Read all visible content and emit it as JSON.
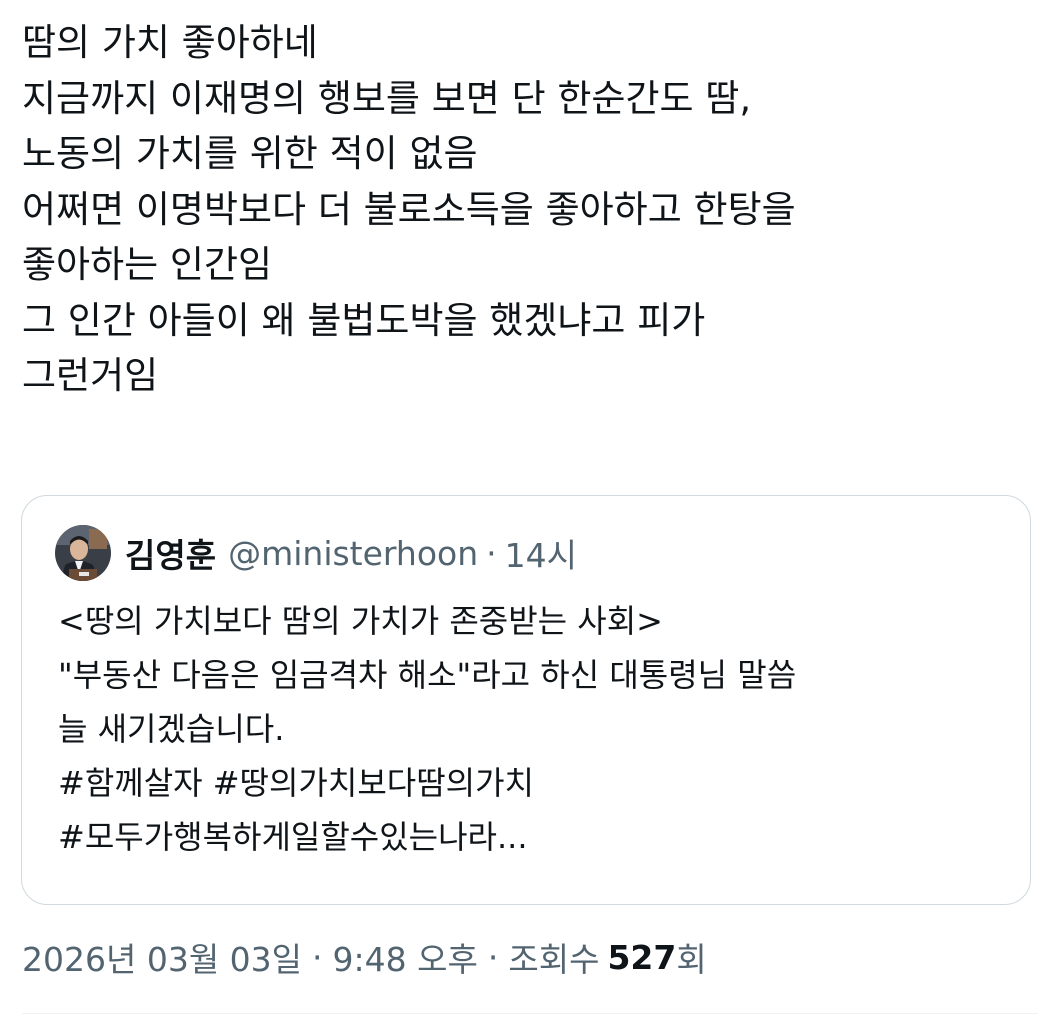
{
  "tweet": {
    "lines": [
      "땀의 가치 좋아하네",
      "지금까지 이재명의 행보를 보면 단 한순간도 땀,",
      "노동의 가치를 위한 적이 없음",
      "어쩌면 이명박보다 더 불로소득을 좋아하고 한탕을",
      "좋아하는 인간임",
      "그 인간 아들이 왜 불법도박을 했겠냐고 피가",
      "그런거임"
    ]
  },
  "quote": {
    "name": "김영훈",
    "handle": "@ministerhoon",
    "separator": "·",
    "time": "14시",
    "lines": [
      "<땅의 가치보다 땀의 가치가 존중받는 사회>",
      " \"부동산 다음은 임금격차 해소\"라고 하신 대통령님 말씀",
      "늘 새기겠습니다.",
      "#함께살자 #땅의가치보다땀의가치",
      "#모두가행복하게일할수있는나라..."
    ]
  },
  "meta": {
    "date": "2026년 03월 03일",
    "separator": "·",
    "time": "9:48 오후",
    "views_label": "조회수",
    "views_count": "527",
    "views_suffix": "회"
  },
  "colors": {
    "text": "#0f1419",
    "secondary": "#536471",
    "border": "#cfd9de"
  },
  "icons": {
    "avatar": "quote-author-avatar"
  }
}
